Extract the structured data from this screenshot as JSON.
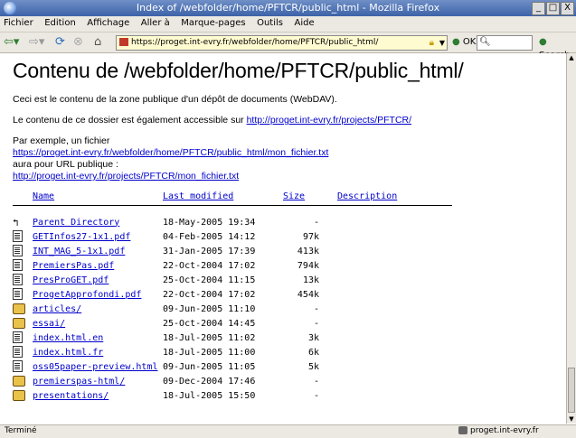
{
  "window": {
    "title": "Index of /webfolder/home/PFTCR/public_html - Mozilla Firefox",
    "buttons": [
      "_",
      "□",
      "X"
    ]
  },
  "menu": [
    "Fichier",
    "Edition",
    "Affichage",
    "Aller à",
    "Marque-pages",
    "Outils",
    "Aide"
  ],
  "navbar": {
    "url": "https://proget.int-evry.fr/webfolder/home/PFTCR/public_html/",
    "ok_label": "OK",
    "search_label": "Search"
  },
  "page": {
    "heading": "Contenu de /webfolder/home/PFTCR/public_html/",
    "para1": "Ceci est le contenu de la zone publique d'un dépôt de documents (WebDAV).",
    "para2_text": "Le contenu de ce dossier est également accessible sur ",
    "para2_link": "http://proget.int-evry.fr/projects/PFTCR/",
    "ex_intro": "Par exemple, un fichier",
    "ex_link1": "https://proget.int-evry.fr/webfolder/home/PFTCR/public_html/mon_fichier.txt",
    "ex_mid": "aura pour URL publique :",
    "ex_link2": "http://proget.int-evry.fr/projects/PFTCR/mon_fichier.txt"
  },
  "listing": {
    "headers": {
      "name": "Name",
      "modified": "Last modified",
      "size": "Size",
      "description": "Description"
    },
    "rows": [
      {
        "icon": "back",
        "name": "Parent Directory",
        "date": "18-May-2005 19:34",
        "size": "-"
      },
      {
        "icon": "file",
        "name": "GETInfos27-1x1.pdf",
        "date": "04-Feb-2005 14:12",
        "size": "97k"
      },
      {
        "icon": "file",
        "name": "INT_MAG_5-1x1.pdf",
        "date": "31-Jan-2005 17:39",
        "size": "413k"
      },
      {
        "icon": "file",
        "name": "PremiersPas.pdf",
        "date": "22-Oct-2004 17:02",
        "size": "794k"
      },
      {
        "icon": "file",
        "name": "PresProGET.pdf",
        "date": "25-Oct-2004 11:15",
        "size": "13k"
      },
      {
        "icon": "file",
        "name": "ProgetApprofondi.pdf",
        "date": "22-Oct-2004 17:02",
        "size": "454k"
      },
      {
        "icon": "folder",
        "name": "articles/",
        "date": "09-Jun-2005 11:10",
        "size": "-"
      },
      {
        "icon": "folder",
        "name": "essai/",
        "date": "25-Oct-2004 14:45",
        "size": "-"
      },
      {
        "icon": "file",
        "name": "index.html.en",
        "date": "18-Jul-2005 11:02",
        "size": "3k"
      },
      {
        "icon": "file",
        "name": "index.html.fr",
        "date": "18-Jul-2005 11:00",
        "size": "6k"
      },
      {
        "icon": "file",
        "name": "oss05paper-preview.html",
        "date": "09-Jun-2005 11:05",
        "size": "5k"
      },
      {
        "icon": "folder",
        "name": "premierspas-html/",
        "date": "09-Dec-2004 17:46",
        "size": "-"
      },
      {
        "icon": "folder",
        "name": "presentations/",
        "date": "18-Jul-2005 15:50",
        "size": "-"
      }
    ]
  },
  "status": {
    "left": "Terminé",
    "right": "proget.int-evry.fr"
  }
}
